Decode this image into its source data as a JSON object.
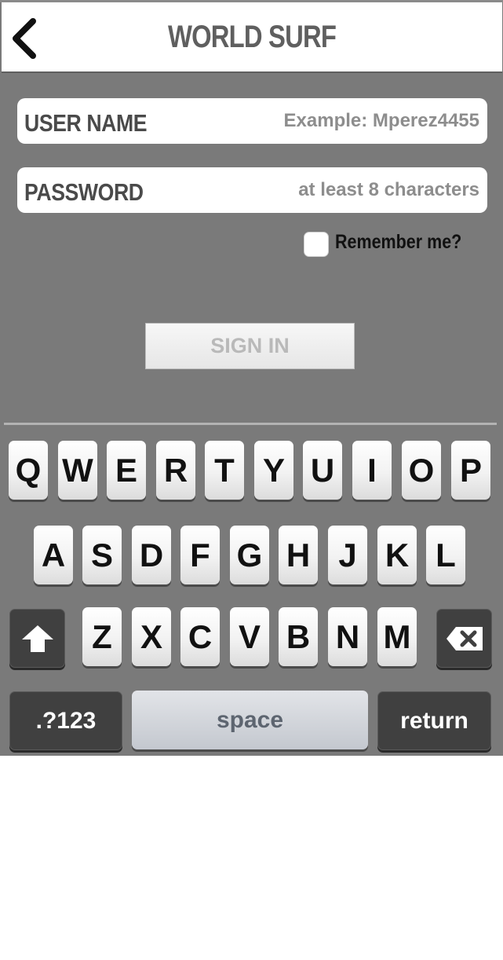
{
  "header": {
    "title": "WORLD SURF",
    "back_icon": "chevron-left-icon"
  },
  "form": {
    "username": {
      "label": "USER NAME",
      "placeholder": "Example: Mperez4455",
      "value": ""
    },
    "password": {
      "label": "PASSWORD",
      "placeholder": "at least 8 characters",
      "value": ""
    },
    "remember": {
      "label": "Remember me?",
      "checked": false
    },
    "sign_in_label": "SIGN IN"
  },
  "keyboard": {
    "row1": [
      "Q",
      "W",
      "E",
      "R",
      "T",
      "Y",
      "U",
      "I",
      "O",
      "P"
    ],
    "row2": [
      "A",
      "S",
      "D",
      "F",
      "G",
      "H",
      "J",
      "K",
      "L"
    ],
    "row3": [
      "Z",
      "X",
      "C",
      "V",
      "B",
      "N",
      "M"
    ],
    "shift_icon": "shift-arrow-icon",
    "backspace_icon": "backspace-icon",
    "numbers_label": ".?123",
    "space_label": "space",
    "return_label": "return"
  },
  "colors": {
    "background": "#7a7a7a",
    "header_text": "#5f5f5f",
    "dark_key": "#404040"
  }
}
